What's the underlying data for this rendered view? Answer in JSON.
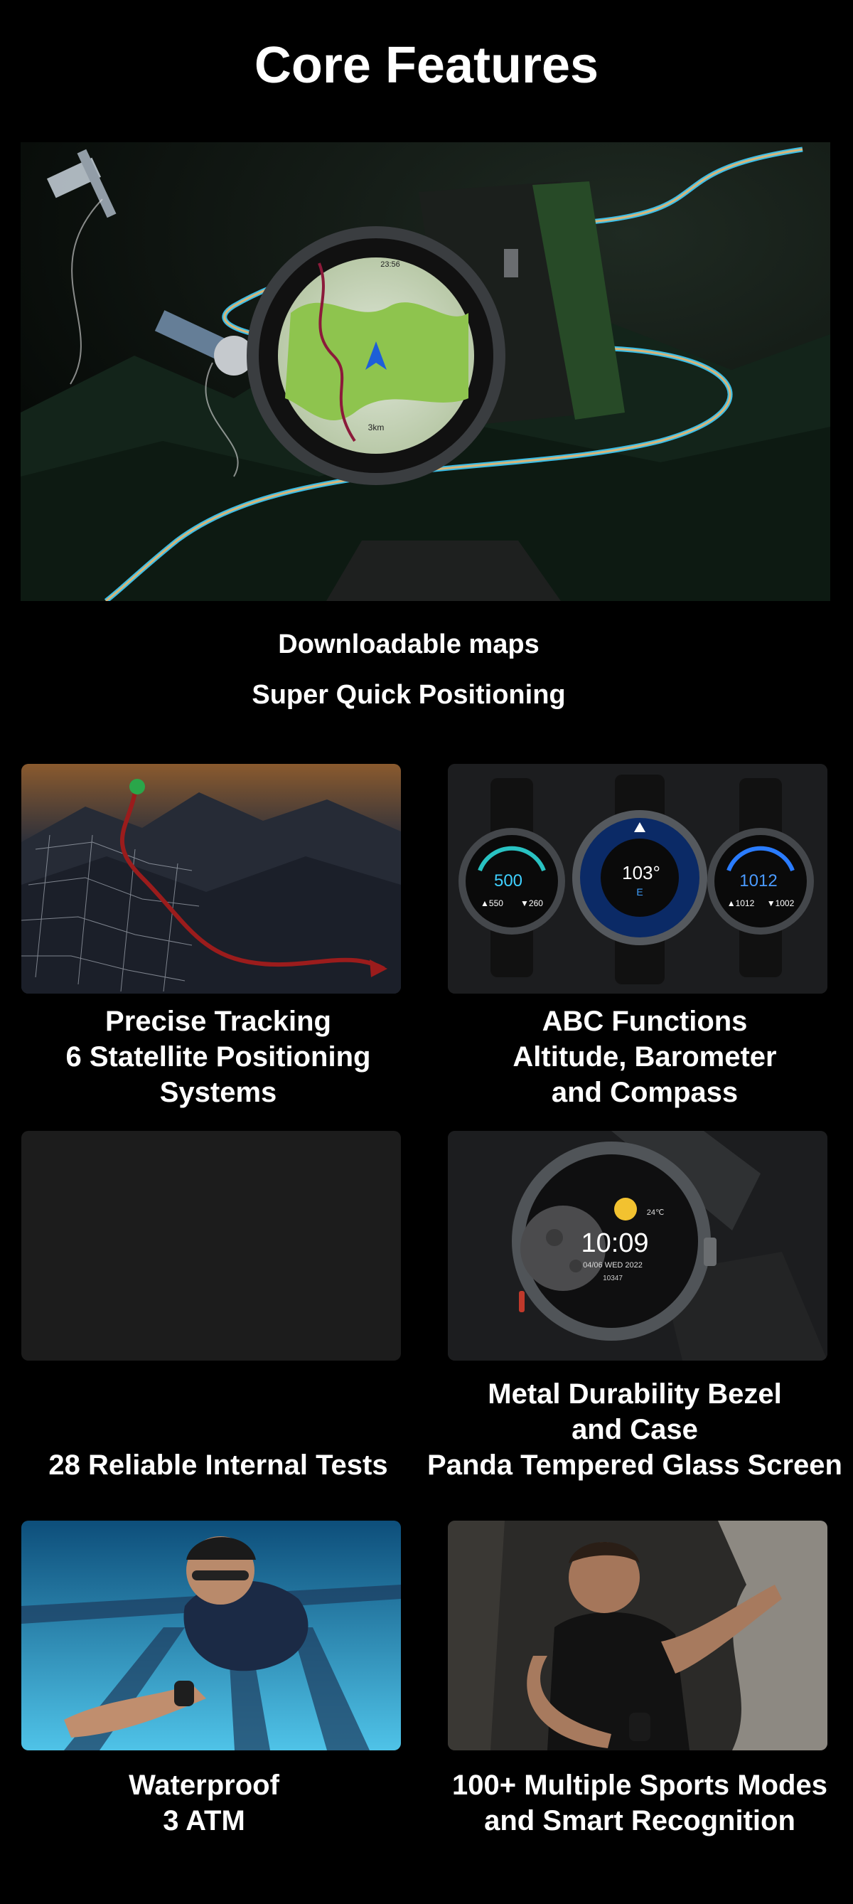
{
  "page": {
    "title": "Core Features"
  },
  "hero": {
    "line1": "Downloadable maps",
    "line2": "Super Quick Positioning",
    "watch_readout": {
      "scale": "3km",
      "time": "23:56"
    }
  },
  "features": [
    {
      "lines": [
        "Precise Tracking",
        "6 Statellite Positioning",
        "Systems"
      ]
    },
    {
      "lines": [
        "ABC Functions",
        "Altitude, Barometer",
        "and Compass"
      ],
      "readouts": {
        "altitude": "500",
        "alt_hi": "▲550",
        "alt_lo": "▼260",
        "compass": "103°",
        "compass_dir": "E",
        "pressure": "1012",
        "pr_hi": "▲1012",
        "pr_lo": "▼1002"
      }
    },
    {
      "lines": [
        "28 Reliable Internal Tests"
      ]
    },
    {
      "lines": [
        "Metal Durability Bezel",
        "and Case",
        "Panda Tempered Glass Screen"
      ],
      "readouts": {
        "time": "10:09",
        "date": "04/06 WED 2022",
        "temp": "24℃",
        "steps": "10347"
      }
    },
    {
      "lines": [
        "Waterproof",
        "3 ATM"
      ]
    },
    {
      "lines": [
        "100+ Multiple Sports Modes",
        "and Smart Recognition"
      ]
    }
  ],
  "colors": {
    "background": "#000000",
    "text": "#ffffff",
    "card": "#1a1a1a",
    "accent_cyan": "#3fd0ff",
    "track_red": "#9b1c1c"
  }
}
